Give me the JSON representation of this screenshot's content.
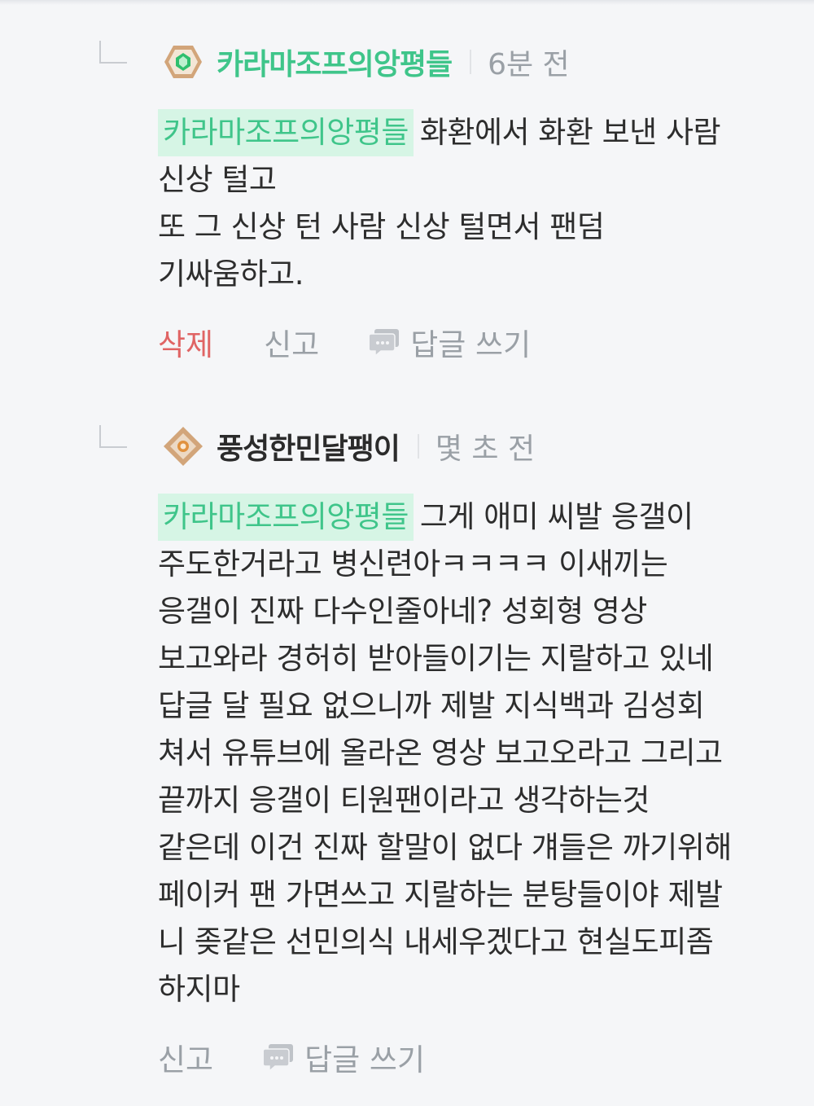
{
  "comments": [
    {
      "nickname": "카라마조프의앙평들",
      "time": "6분 전",
      "mention": "카라마조프의앙평들",
      "first_line_rest": "화환에서 화환 보낸 사람",
      "lines": [
        "신상 털고",
        "또 그 신상 턴 사람 신상 털면서 팬덤",
        "기싸움하고."
      ],
      "actions": {
        "delete": "삭제",
        "report": "신고",
        "reply": "답글 쓰기"
      }
    },
    {
      "nickname": "풍성한민달팽이",
      "time": "몇 초 전",
      "mention": "카라마조프의앙평들",
      "first_line_rest": "그게 애미 씨발 응갤이",
      "lines": [
        "주도한거라고 병신련아ㅋㅋㅋㅋ 이새끼는",
        "응갤이 진짜 다수인줄아네? 성회형 영상",
        "보고와라 경허히 받아들이기는 지랄하고 있네",
        "답글 달 필요 없으니까 제발 지식백과 김성회",
        "쳐서 유튜브에 올라온 영상 보고오라고 그리고",
        "끝까지 응갤이 티원팬이라고 생각하는것",
        "같은데 이건 진짜 할말이 없다 걔들은 까기위해",
        "페이커 팬 가면쓰고 지랄하는 분탕들이야 제발",
        "니 좆같은 선민의식 내세우겠다고 현실도피좀",
        "하지마"
      ],
      "actions": {
        "report": "신고",
        "reply": "답글 쓰기"
      }
    }
  ],
  "colors": {
    "mention_text": "#3fc58a",
    "mention_bg": "#d6f5e5",
    "delete": "#e06464",
    "muted": "#9aa0a6",
    "text": "#2d2d2d"
  },
  "icons": {
    "badge_1": "green-gem-hexagon-badge-icon",
    "badge_2": "brown-diamond-badge-icon",
    "reply": "speech-bubble-icon"
  }
}
